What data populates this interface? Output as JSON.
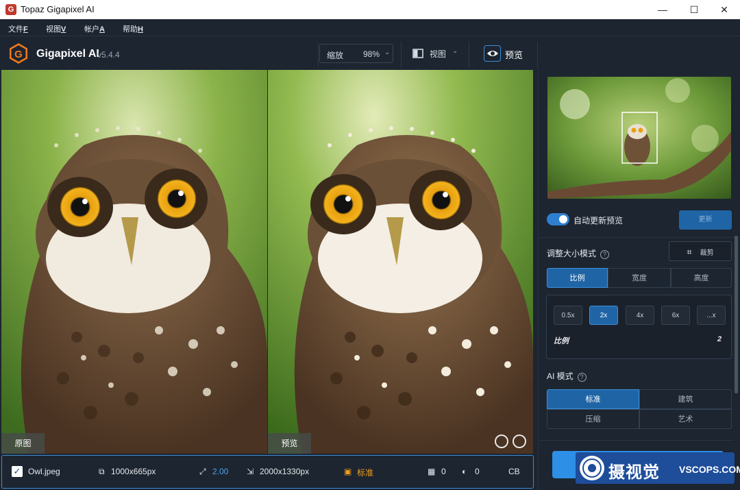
{
  "window": {
    "title": "Topaz Gigapixel AI",
    "icon": "G",
    "minimize": "—",
    "maximize": "☐",
    "close": "✕"
  },
  "menu": [
    {
      "label": "文件",
      "key": "F"
    },
    {
      "label": "视图",
      "key": "V"
    },
    {
      "label": "帐户",
      "key": "A"
    },
    {
      "label": "帮助",
      "key": "H"
    }
  ],
  "header": {
    "app_name": "Gigapixel AI",
    "version": "v5.4.4",
    "zoom_label": "缩放",
    "zoom_value": "98%",
    "view_label": "视图",
    "preview_label": "预览"
  },
  "panes": {
    "original_label": "原图",
    "preview_label": "预览"
  },
  "status": {
    "filename": "Owl.jpeg",
    "input_size": "1000x665px",
    "scale": "2.00",
    "output_size": "2000x1330px",
    "mode": "标准",
    "noise": "0",
    "blur": "0",
    "format": "CB"
  },
  "right_panel": {
    "auto_update_label": "自动更新预览",
    "update_button": "更新",
    "resize_mode_label": "调整大小模式",
    "crop_button": "裁剪",
    "resize_tabs": [
      "比例",
      "宽度",
      "高度"
    ],
    "scale_options": [
      "0.5x",
      "2x",
      "4x",
      "6x",
      "...x"
    ],
    "scale_label": "比例",
    "scale_value": "2",
    "ai_mode_label": "AI 模式",
    "ai_modes": [
      "标准",
      "建筑",
      "压缩",
      "艺术"
    ]
  },
  "watermark": {
    "text": "摄视觉",
    "sub": "VSCOPS.COM"
  },
  "colors": {
    "accent": "#2d8fe6",
    "panel_bg": "#1d2530",
    "active_seg": "#1f65a6"
  }
}
